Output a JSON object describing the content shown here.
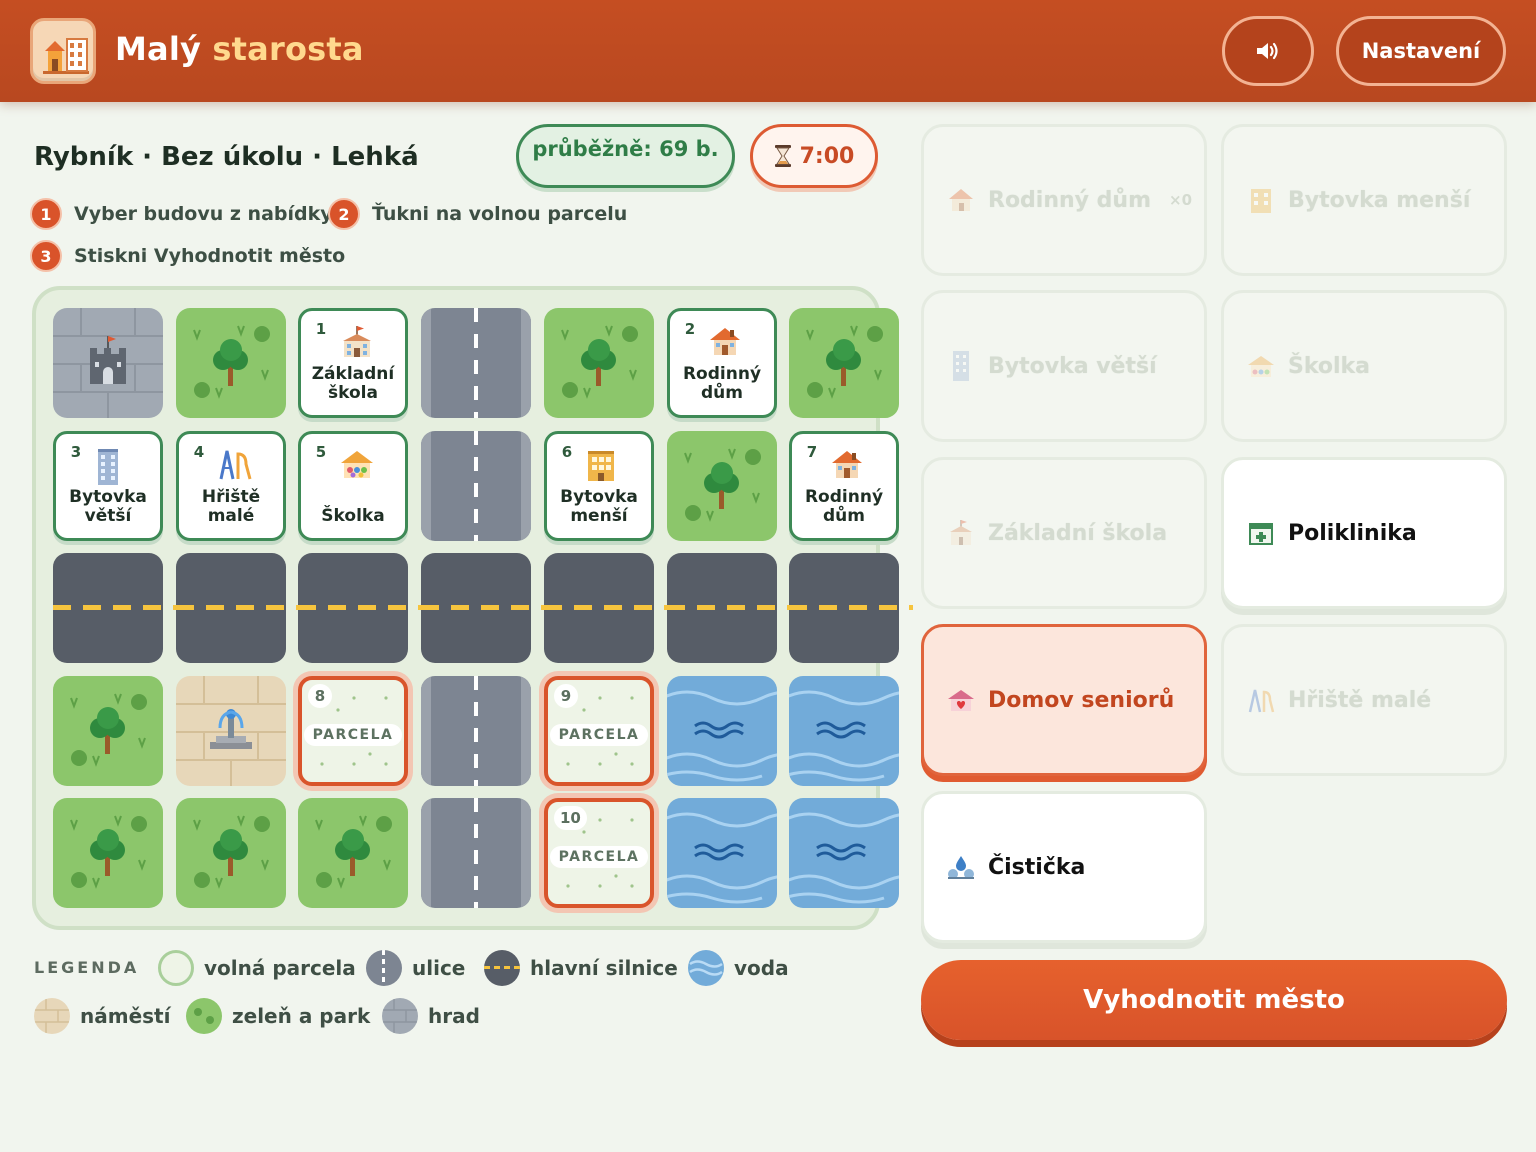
{
  "header": {
    "title_part1": "Malý",
    "title_part2": "starosta",
    "settings_label": "Nastavení",
    "sound_icon": "speaker-icon",
    "logo_icon": "town-logo-icon"
  },
  "level": {
    "title": "Rybník · Bez úkolu · Lehká",
    "score_label": "průběžně: 69 b.",
    "timer": "7:00"
  },
  "steps": [
    {
      "num": "1",
      "text": "Vyber budovu z nabídky"
    },
    {
      "num": "2",
      "text": "Ťukni na volnou parcelu"
    },
    {
      "num": "3",
      "text": "Stiskni Vyhodnotit město"
    }
  ],
  "board": {
    "rows": 5,
    "cols": 7,
    "tiles": [
      {
        "type": "castle"
      },
      {
        "type": "park"
      },
      {
        "type": "building",
        "num": "1",
        "label": "Základní škola",
        "icon": "school-icon"
      },
      {
        "type": "street"
      },
      {
        "type": "park"
      },
      {
        "type": "building",
        "num": "2",
        "label": "Rodinný dům",
        "icon": "house-icon"
      },
      {
        "type": "park"
      },
      {
        "type": "building",
        "num": "3",
        "label": "Bytovka větší",
        "icon": "tall-apartment-icon"
      },
      {
        "type": "building",
        "num": "4",
        "label": "Hřiště malé",
        "icon": "playground-icon"
      },
      {
        "type": "building",
        "num": "5",
        "label": "Školka",
        "icon": "kindergarten-icon"
      },
      {
        "type": "street"
      },
      {
        "type": "building",
        "num": "6",
        "label": "Bytovka menší",
        "icon": "small-apartment-icon"
      },
      {
        "type": "park"
      },
      {
        "type": "building",
        "num": "7",
        "label": "Rodinný dům",
        "icon": "house-icon"
      },
      {
        "type": "main"
      },
      {
        "type": "main"
      },
      {
        "type": "main"
      },
      {
        "type": "main"
      },
      {
        "type": "main"
      },
      {
        "type": "main"
      },
      {
        "type": "main"
      },
      {
        "type": "park"
      },
      {
        "type": "square"
      },
      {
        "type": "lot",
        "num": "8",
        "label": "PARCELA"
      },
      {
        "type": "street"
      },
      {
        "type": "lot",
        "num": "9",
        "label": "PARCELA"
      },
      {
        "type": "water"
      },
      {
        "type": "water"
      },
      {
        "type": "park"
      },
      {
        "type": "park"
      },
      {
        "type": "park"
      },
      {
        "type": "street"
      },
      {
        "type": "lot",
        "num": "10",
        "label": "PARCELA"
      },
      {
        "type": "water"
      },
      {
        "type": "water"
      }
    ]
  },
  "legend": {
    "title": "LEGENDA",
    "items": [
      {
        "key": "lot",
        "label": "volná parcela"
      },
      {
        "key": "street",
        "label": "ulice"
      },
      {
        "key": "main",
        "label": "hlavní silnice"
      },
      {
        "key": "water",
        "label": "voda"
      },
      {
        "key": "square",
        "label": "náměstí"
      },
      {
        "key": "park",
        "label": "zeleň a park"
      },
      {
        "key": "castle",
        "label": "hrad"
      }
    ]
  },
  "cards": [
    {
      "label": "Rodinný dům",
      "count": "×0",
      "state": "used",
      "icon": "house-icon"
    },
    {
      "label": "Bytovka menší",
      "state": "used",
      "icon": "small-apartment-icon"
    },
    {
      "label": "Bytovka větší",
      "state": "used",
      "icon": "tall-apartment-icon"
    },
    {
      "label": "Školka",
      "state": "used",
      "icon": "kindergarten-icon"
    },
    {
      "label": "Základní škola",
      "state": "used",
      "icon": "school-icon"
    },
    {
      "label": "Poliklinika",
      "state": "available",
      "icon": "clinic-icon"
    },
    {
      "label": "Domov seniorů",
      "state": "selected",
      "icon": "senior-home-icon"
    },
    {
      "label": "Hřiště malé",
      "state": "used",
      "icon": "playground-icon"
    },
    {
      "label": "Čistička",
      "state": "available",
      "icon": "water-treatment-icon"
    }
  ],
  "evaluate_label": "Vyhodnotit město",
  "colors": {
    "header": "#c54e22",
    "accent": "#d9532a",
    "green": "#3e8a56",
    "park": "#8cc66b",
    "water": "#72abd9",
    "road": "#575d67"
  }
}
